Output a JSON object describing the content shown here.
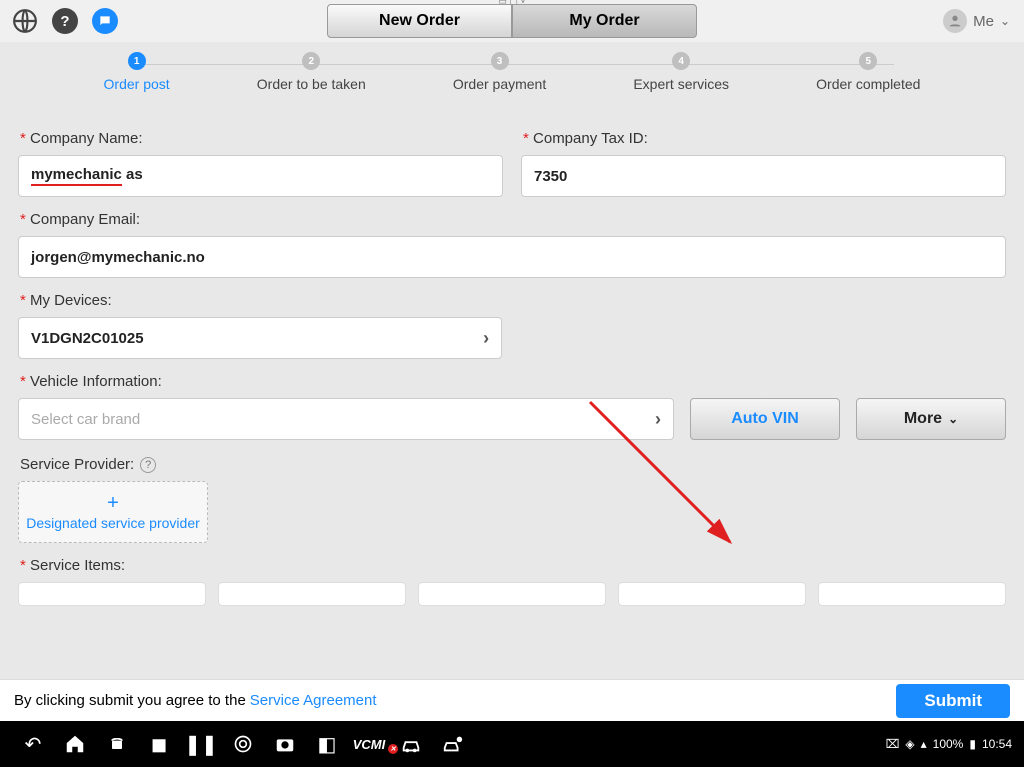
{
  "tabs": {
    "new_order": "New Order",
    "my_order": "My Order"
  },
  "user": {
    "label": "Me"
  },
  "steps": [
    {
      "n": "1",
      "label": "Order post"
    },
    {
      "n": "2",
      "label": "Order to be taken"
    },
    {
      "n": "3",
      "label": "Order payment"
    },
    {
      "n": "4",
      "label": "Expert services"
    },
    {
      "n": "5",
      "label": "Order completed"
    }
  ],
  "form": {
    "company_name_label": "Company Name:",
    "company_name_value_u": "mymechanic",
    "company_name_value_rest": " as",
    "company_tax_label": "Company Tax ID:",
    "company_tax_value": "7350",
    "company_email_label": "Company Email:",
    "company_email_value": "jorgen@mymechanic.no",
    "my_devices_label": "My Devices:",
    "my_devices_value": "V1DGN2C01025",
    "vehicle_info_label": "Vehicle Information:",
    "vehicle_info_placeholder": "Select car brand",
    "auto_vin": "Auto VIN",
    "more": "More",
    "service_provider_label": "Service Provider:",
    "add_provider": "Designated service provider",
    "service_items_label": "Service Items:"
  },
  "footer": {
    "text": "By clicking submit you agree to the",
    "link": "Service Agreement",
    "submit": "Submit"
  },
  "sysbar": {
    "vcmi": "VCMI",
    "battery": "100%",
    "time": "10:54"
  }
}
